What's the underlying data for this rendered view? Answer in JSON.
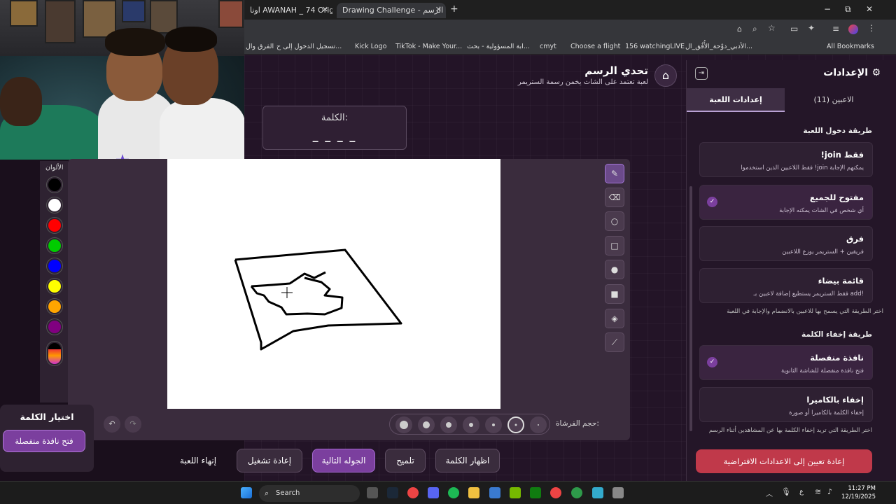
{
  "browser": {
    "tabs": [
      {
        "label": "اونا AWANAH _ 74 Original AE"
      },
      {
        "label": "Drawing Challenge - تحدي الرسم"
      }
    ],
    "add_tab": "+",
    "close_glyph": "✕",
    "window_controls": {
      "minimize": "−",
      "restore": "⧉",
      "close": "✕"
    },
    "bookmarks": [
      "الفرق وال",
      "تسجيل الدخول إلى ح...",
      "Kick Logo",
      "TikTok - Make Your...",
      "ابة المسؤولية - بحث...",
      "cmyt",
      "Choose a flight",
      "156 watchingLIVE",
      "الأدبي_دوْحة_الأُفُق_ال...",
      "All Bookmarks"
    ]
  },
  "app": {
    "title": "تحدي الرسم",
    "subtitle": "لعبة تعتمد على الشات يخمن رسمة الستريمر",
    "word": {
      "label": "الكلمة:",
      "value": "_ _ _ _"
    },
    "colors_label": "الألوان",
    "colors": [
      "#000000",
      "#ffffff",
      "#ff0000",
      "#00cc00",
      "#0000ff",
      "#ffff00",
      "#ffa500",
      "#800080"
    ],
    "brush_label": "حجم الفرشاة:",
    "buttons": {
      "show_word": "اظهار الكلمة",
      "hint": "تلميح",
      "next_round": "الجوله التالية",
      "restart": "إعادة تشغيل",
      "end_game": "إنهاء اللعبة"
    },
    "choice": {
      "title": "اختيار الكلمة",
      "button": "فتح نافذة منفصلة"
    }
  },
  "settings": {
    "title": "الإعدادات",
    "tabs": [
      {
        "label": "الاعبين (11)"
      },
      {
        "label": "إعدادات اللعبة"
      }
    ],
    "section_join": "طريقة دخول اللعبة",
    "join_options": [
      {
        "title": "!join فقط",
        "desc": "فقط اللاعبين الذين استخدموا !join يمكنهم الإجابة"
      },
      {
        "title": "مفتوح للجميع",
        "desc": "أي شخص في الشات يمكنه الإجابة",
        "check": "✓"
      },
      {
        "title": "فرق",
        "desc": "فريقين + الستريمر يوزع اللاعبين"
      },
      {
        "title": "قائمة بيضاء",
        "desc": "فقط الستريمر يستطيع إضافة لاعبين بـ add!"
      }
    ],
    "join_note": "اختر الطريقة التي يسمح بها للاعبين بالانضمام والإجابة في اللعبة",
    "section_hide": "طريقة إخفاء الكلمة",
    "hide_options": [
      {
        "title": "نافذة منفصلة",
        "desc": "فتح نافذة منفصلة للشاشة الثانوية",
        "check": "✓"
      },
      {
        "title": "إخفاء بالكاميرا",
        "desc": "إخفاء الكلمة بالكاميرا أو صورة"
      }
    ],
    "hide_note": "اختر الطريقة التي تريد إخفاء الكلمة بها عن المشاهدين أثناء الرسم",
    "reset": "إعادة تعيين إلى الاعدادات الافتراضية"
  },
  "taskbar": {
    "search": "Search",
    "time": "11:27 PM",
    "date": "12/19/2025",
    "lang": "ع"
  }
}
